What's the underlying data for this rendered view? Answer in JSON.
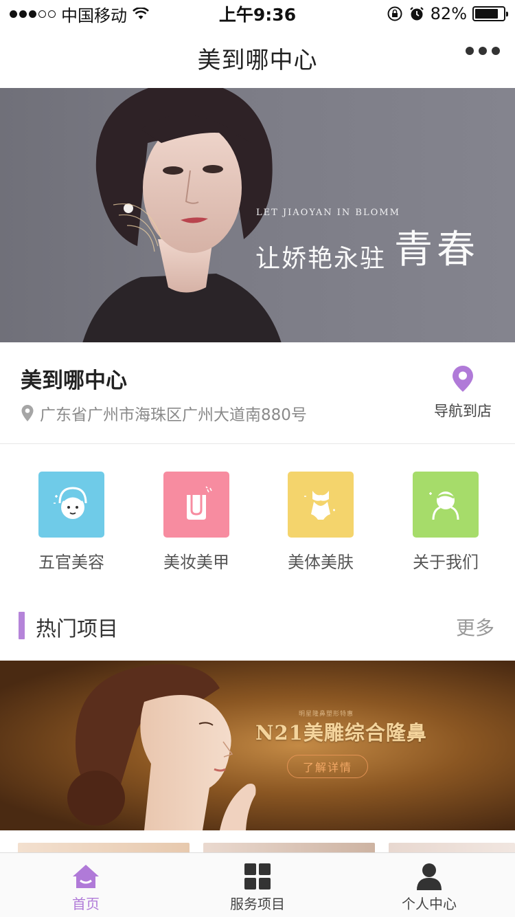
{
  "status_bar": {
    "carrier": "中国移动",
    "time": "上午9:36",
    "battery_text": "82%",
    "battery_level": 0.82
  },
  "nav": {
    "title": "美到哪中心",
    "more_icon": "more-dots-icon"
  },
  "hero": {
    "subtitle": "LET JIAOYAN IN BLOMM",
    "headline_small": "让娇艳永驻",
    "headline_big": "青春"
  },
  "store": {
    "name": "美到哪中心",
    "address": "广东省广州市海珠区广州大道南880号",
    "navigate_label": "导航到店",
    "navigate_icon": "map-pin-icon",
    "accent": "#b07ad8"
  },
  "categories": [
    {
      "label": "五官美容",
      "icon": "face-care-icon",
      "color": "#6fcbe8"
    },
    {
      "label": "美妆美甲",
      "icon": "nail-icon",
      "color": "#f78ca0"
    },
    {
      "label": "美体美肤",
      "icon": "body-icon",
      "color": "#f4d46c"
    },
    {
      "label": "关于我们",
      "icon": "about-icon",
      "color": "#a6dc6a"
    }
  ],
  "section": {
    "title": "热门项目",
    "more": "更多",
    "accent": "#b584d9"
  },
  "promo": {
    "caption": "明星隆鼻塑形特惠",
    "title": "N21美雕综合隆鼻",
    "button": "了解详情"
  },
  "tabbar": {
    "items": [
      {
        "label": "首页",
        "icon": "home-icon",
        "active": true
      },
      {
        "label": "服务项目",
        "icon": "grid-icon",
        "active": false
      },
      {
        "label": "个人中心",
        "icon": "user-icon",
        "active": false
      }
    ],
    "active_color": "#b07ad8"
  }
}
